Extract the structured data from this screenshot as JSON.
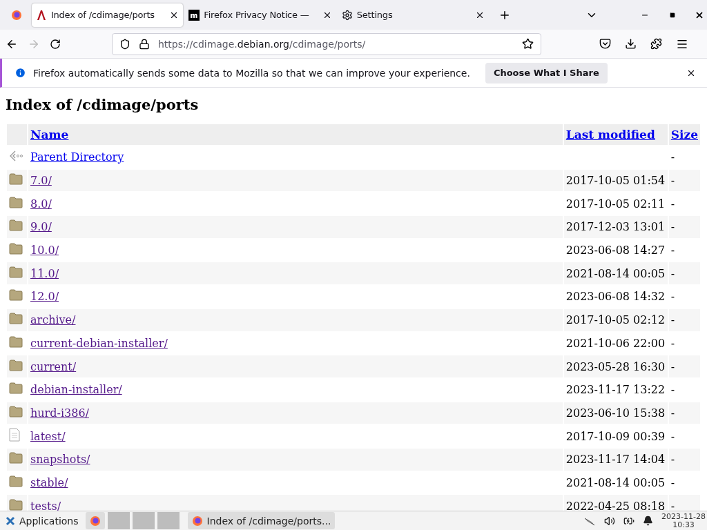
{
  "tabs": [
    {
      "title": "Index of /cdimage/ports",
      "kind": "debian",
      "selected": true
    },
    {
      "title": "Firefox Privacy Notice —",
      "kind": "mozilla",
      "selected": false
    },
    {
      "title": "Settings",
      "kind": "gear",
      "selected": false
    }
  ],
  "address_bar": {
    "prefix": "https://cdimage.",
    "domain": "debian.org",
    "path": "/cdimage/ports/"
  },
  "notification": {
    "message": "Firefox automatically sends some data to Mozilla so that we can improve your experience.",
    "button": "Choose What I Share"
  },
  "page": {
    "heading": "Index of /cdimage/ports",
    "table": {
      "columns": [
        "Name",
        "Last modified",
        "Size"
      ],
      "rows": [
        {
          "kind": "parent",
          "name": "Parent Directory",
          "modified": "",
          "size": "-",
          "visited": false
        },
        {
          "kind": "folder",
          "name": "7.0/",
          "modified": "2017-10-05 01:54",
          "size": "-",
          "visited": true
        },
        {
          "kind": "folder",
          "name": "8.0/",
          "modified": "2017-10-05 02:11",
          "size": "-",
          "visited": true
        },
        {
          "kind": "folder",
          "name": "9.0/",
          "modified": "2017-12-03 13:01",
          "size": "-",
          "visited": true
        },
        {
          "kind": "folder",
          "name": "10.0/",
          "modified": "2023-06-08 14:27",
          "size": "-",
          "visited": true
        },
        {
          "kind": "folder",
          "name": "11.0/",
          "modified": "2021-08-14 00:05",
          "size": "-",
          "visited": true
        },
        {
          "kind": "folder",
          "name": "12.0/",
          "modified": "2023-06-08 14:32",
          "size": "-",
          "visited": true
        },
        {
          "kind": "folder",
          "name": "archive/",
          "modified": "2017-10-05 02:12",
          "size": "-",
          "visited": true
        },
        {
          "kind": "folder",
          "name": "current-debian-installer/",
          "modified": "2021-10-06 22:00",
          "size": "-",
          "visited": true
        },
        {
          "kind": "folder",
          "name": "current/",
          "modified": "2023-05-28 16:30",
          "size": "-",
          "visited": true
        },
        {
          "kind": "folder",
          "name": "debian-installer/",
          "modified": "2023-11-17 13:22",
          "size": "-",
          "visited": true
        },
        {
          "kind": "folder",
          "name": "hurd-i386/",
          "modified": "2023-06-10 15:38",
          "size": "-",
          "visited": true
        },
        {
          "kind": "file",
          "name": "latest/",
          "modified": "2017-10-09 00:39",
          "size": "-",
          "visited": true
        },
        {
          "kind": "folder",
          "name": "snapshots/",
          "modified": "2023-11-17 14:04",
          "size": "-",
          "visited": true
        },
        {
          "kind": "folder",
          "name": "stable/",
          "modified": "2021-08-14 00:05",
          "size": "-",
          "visited": true
        },
        {
          "kind": "folder",
          "name": "tests/",
          "modified": "2022-04-25 08:18",
          "size": "-",
          "visited": true
        }
      ]
    }
  },
  "taskbar": {
    "menu": "Applications",
    "task": "Index of /cdimage/ports...",
    "date": "2023-11-28",
    "time": "10:33"
  }
}
